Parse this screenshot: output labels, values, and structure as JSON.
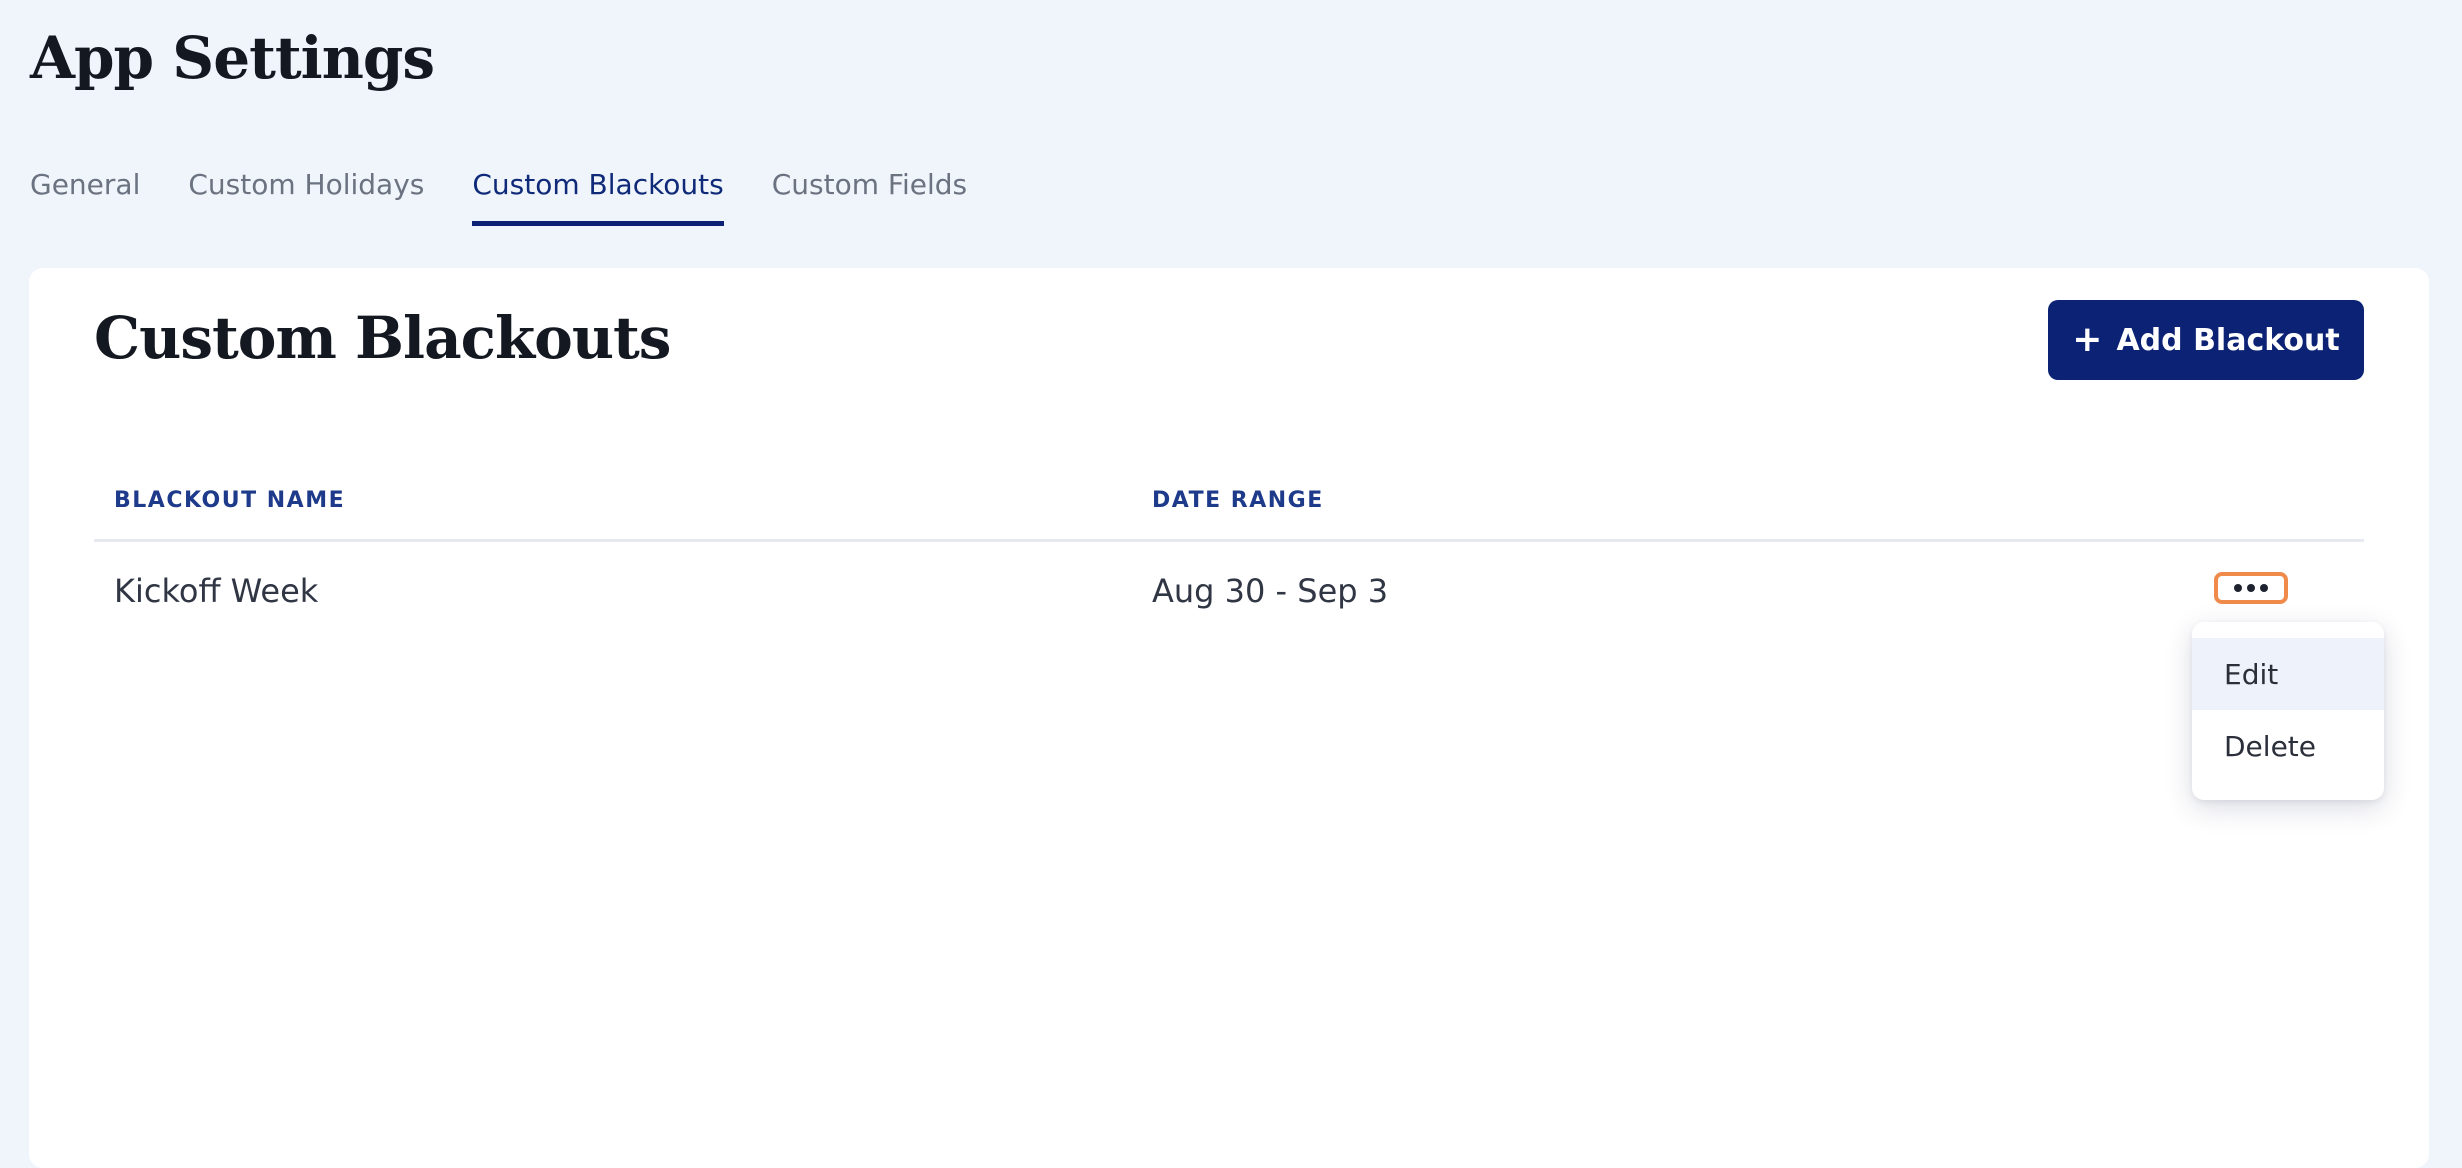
{
  "page": {
    "title": "App Settings"
  },
  "tabs": [
    {
      "label": "General",
      "active": false
    },
    {
      "label": "Custom Holidays",
      "active": false
    },
    {
      "label": "Custom Blackouts",
      "active": true
    },
    {
      "label": "Custom Fields",
      "active": false
    }
  ],
  "panel": {
    "title": "Custom Blackouts",
    "add_button": {
      "icon": "plus-icon",
      "label": "Add Blackout"
    }
  },
  "table": {
    "headers": {
      "name": "Blackout Name",
      "range": "Date Range"
    },
    "rows": [
      {
        "name": "Kickoff Week",
        "range": "Aug 30 - Sep 3"
      }
    ]
  },
  "row_menu": {
    "trigger_icon": "more-horizontal-icon",
    "items": [
      "Edit",
      "Delete"
    ]
  },
  "colors": {
    "background": "#f0f4fb",
    "brand": "#0b2275",
    "focus_ring": "#f08a4b",
    "header_text": "#1e3a8a"
  }
}
